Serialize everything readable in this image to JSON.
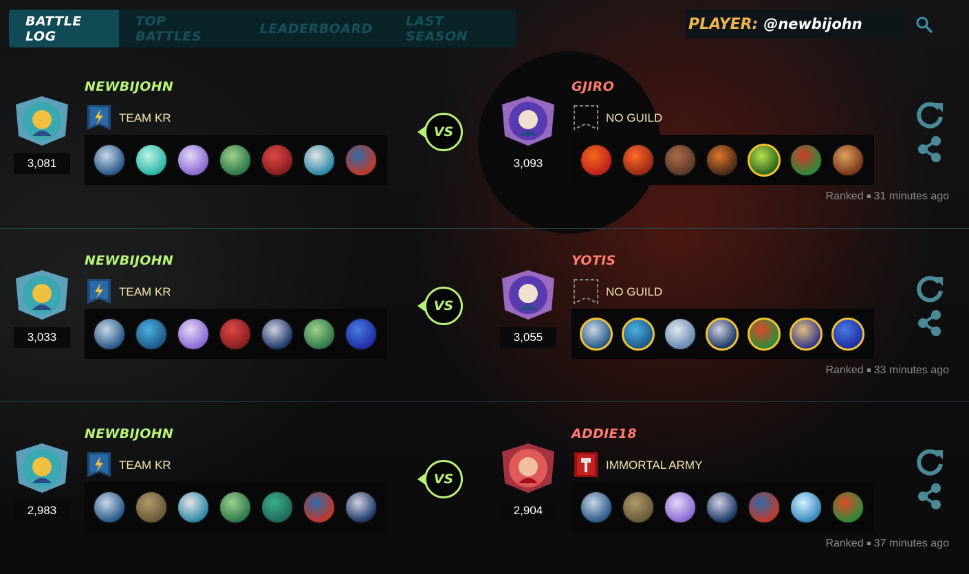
{
  "nav": {
    "tabs": [
      "BATTLE LOG",
      "TOP BATTLES",
      "LEADERBOARD",
      "LAST SEASON"
    ],
    "active_index": 0
  },
  "player": {
    "label": "PLAYER:",
    "name": "@newbijohn"
  },
  "icons": {
    "search": "search-icon",
    "replay": "refresh-icon",
    "share": "share-icon"
  },
  "colors": {
    "left_name": "#b8f27a",
    "right_name": "#ff7b6e",
    "gold_border": "#f1c232",
    "vs": "#b8f27a"
  },
  "battles": [
    {
      "left": {
        "name": "NEWBIJOHN",
        "rating": "3,081",
        "guild": "TEAM KR",
        "guild_icon": "lightning-banner-icon",
        "cards": [
          {
            "c1": "#2b5b8a",
            "c2": "#c9d6e6",
            "gold": false
          },
          {
            "c1": "#2fb6a8",
            "c2": "#b9f3e8",
            "gold": false
          },
          {
            "c1": "#8a6bd3",
            "c2": "#e3d7f7",
            "gold": false
          },
          {
            "c1": "#2f7a4a",
            "c2": "#9dd08c",
            "gold": false
          },
          {
            "c1": "#8a1f1f",
            "c2": "#e04848",
            "gold": false
          },
          {
            "c1": "#2f8aa8",
            "c2": "#e3e3e3",
            "gold": false
          },
          {
            "c1": "#c0392b",
            "c2": "#2f6aa8",
            "gold": false
          }
        ]
      },
      "right": {
        "name": "GJIRO",
        "rating": "3,093",
        "guild": "NO GUILD",
        "guild_icon": "empty-banner-icon",
        "cards": [
          {
            "c1": "#c0201b",
            "c2": "#f26a1b",
            "gold": false
          },
          {
            "c1": "#9a2a14",
            "c2": "#ff6a2a",
            "gold": false
          },
          {
            "c1": "#5a3a2a",
            "c2": "#b06a4a",
            "gold": false
          },
          {
            "c1": "#4a2a1a",
            "c2": "#e0762a",
            "gold": false
          },
          {
            "c1": "#2f6a1f",
            "c2": "#b8e04a",
            "gold": true
          },
          {
            "c1": "#2f8a3a",
            "c2": "#d43a2a",
            "gold": false
          },
          {
            "c1": "#7a3a1a",
            "c2": "#e0a060",
            "gold": false
          }
        ]
      },
      "mode": "Ranked",
      "time": "31 minutes ago"
    },
    {
      "left": {
        "name": "NEWBIJOHN",
        "rating": "3,033",
        "guild": "TEAM KR",
        "guild_icon": "lightning-banner-icon",
        "cards": [
          {
            "c1": "#2b5b8a",
            "c2": "#c9d6e6",
            "gold": false
          },
          {
            "c1": "#1f5a8a",
            "c2": "#4ab0e0",
            "gold": false
          },
          {
            "c1": "#8a6bd3",
            "c2": "#e3d7f7",
            "gold": false
          },
          {
            "c1": "#8a1f1f",
            "c2": "#e04848",
            "gold": false
          },
          {
            "c1": "#1f3a6a",
            "c2": "#d0d0e0",
            "gold": false
          },
          {
            "c1": "#2f7a4a",
            "c2": "#9dd08c",
            "gold": false
          },
          {
            "c1": "#1f2fa8",
            "c2": "#4a7ae0",
            "gold": false
          }
        ]
      },
      "right": {
        "name": "YOTIS",
        "rating": "3,055",
        "guild": "NO GUILD",
        "guild_icon": "empty-banner-icon",
        "cards": [
          {
            "c1": "#2b5b8a",
            "c2": "#c9d6e6",
            "gold": true
          },
          {
            "c1": "#1f5a8a",
            "c2": "#4ab0e0",
            "gold": true
          },
          {
            "c1": "#6a8ab0",
            "c2": "#e0e8f0",
            "gold": false
          },
          {
            "c1": "#1f3a6a",
            "c2": "#d0d0e0",
            "gold": true
          },
          {
            "c1": "#2f8a3a",
            "c2": "#e04a2a",
            "gold": true
          },
          {
            "c1": "#3a3a8a",
            "c2": "#e0c080",
            "gold": true
          },
          {
            "c1": "#1f2fa8",
            "c2": "#4a7ae0",
            "gold": true
          }
        ]
      },
      "mode": "Ranked",
      "time": "33 minutes ago"
    },
    {
      "left": {
        "name": "NEWBIJOHN",
        "rating": "2,983",
        "guild": "TEAM KR",
        "guild_icon": "lightning-banner-icon",
        "cards": [
          {
            "c1": "#2b5b8a",
            "c2": "#c9d6e6",
            "gold": false
          },
          {
            "c1": "#6a5a3a",
            "c2": "#b09a6a",
            "gold": false
          },
          {
            "c1": "#2f8aa8",
            "c2": "#e3e3e3",
            "gold": false
          },
          {
            "c1": "#2f7a4a",
            "c2": "#9dd08c",
            "gold": false
          },
          {
            "c1": "#1f6a5a",
            "c2": "#3ab08a",
            "gold": false
          },
          {
            "c1": "#c0392b",
            "c2": "#2f6aa8",
            "gold": false
          },
          {
            "c1": "#1f3a6a",
            "c2": "#d0d0e0",
            "gold": false
          }
        ]
      },
      "right": {
        "name": "ADDIE18",
        "rating": "2,904",
        "guild": "IMMORTAL ARMY",
        "guild_icon": "hammer-banner-icon",
        "cards": [
          {
            "c1": "#2b5b8a",
            "c2": "#c9d6e6",
            "gold": false
          },
          {
            "c1": "#6a5a3a",
            "c2": "#b09a6a",
            "gold": false
          },
          {
            "c1": "#8a6bd3",
            "c2": "#e3d7f7",
            "gold": false
          },
          {
            "c1": "#1f3a6a",
            "c2": "#d0d0e0",
            "gold": false
          },
          {
            "c1": "#c0392b",
            "c2": "#2f6aa8",
            "gold": false
          },
          {
            "c1": "#3a8ac0",
            "c2": "#d0f0ff",
            "gold": false
          },
          {
            "c1": "#2f8a3a",
            "c2": "#e04a2a",
            "gold": false
          }
        ]
      },
      "mode": "Ranked",
      "time": "37 minutes ago"
    }
  ]
}
